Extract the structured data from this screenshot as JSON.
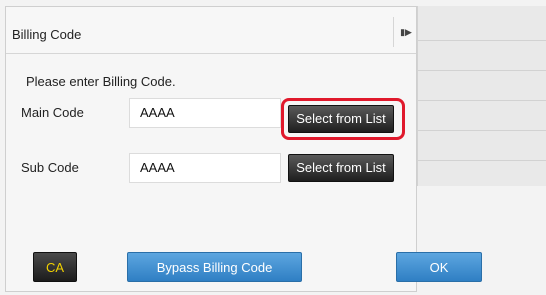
{
  "dialog": {
    "title": "Billing Code",
    "prompt": "Please enter Billing Code."
  },
  "main_code": {
    "label": "Main Code",
    "value": "AAAA",
    "button_label": "Select from List",
    "highlighted": true
  },
  "sub_code": {
    "label": "Sub Code",
    "value": "AAAA",
    "button_label": "Select from List"
  },
  "footer": {
    "ca_label": "CA",
    "bypass_label": "Bypass Billing Code",
    "ok_label": "OK"
  },
  "colors": {
    "highlight": "#e0192c",
    "primary_button": "#3a8ad0",
    "ca_text": "#f0d000"
  },
  "icons": {
    "side_toggle": "play-triangle-icon"
  }
}
